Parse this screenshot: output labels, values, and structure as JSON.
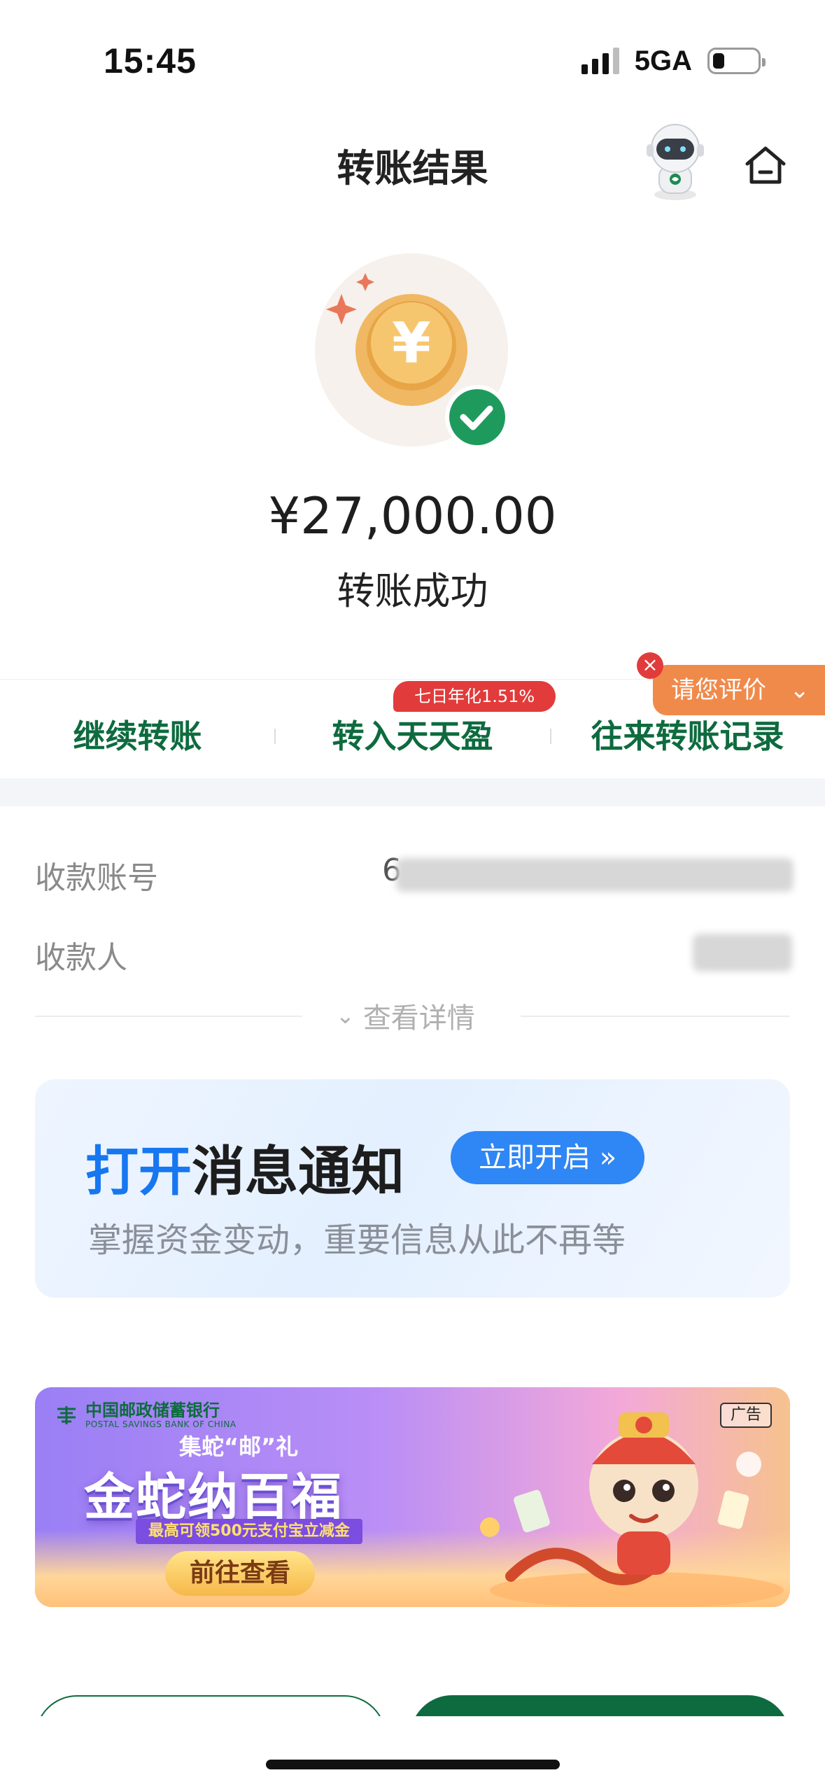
{
  "status_bar": {
    "time": "15:45",
    "network": "5GA",
    "signal_bars": 3,
    "battery_level": 0.2
  },
  "header": {
    "title": "转账结果",
    "mascot_icon": "astronaut-mascot-icon",
    "home_icon": "home-icon"
  },
  "result": {
    "icon": "coin-success-icon",
    "amount": "¥27,000.00",
    "status": "转账成功"
  },
  "actions": {
    "continue_transfer": "继续转账",
    "transfer_in": "转入天天盈",
    "promo_badge": "七日年化1.51%",
    "history": "往来转账记录",
    "rate_tab": "请您评价",
    "rate_close_icon": "close-icon",
    "accent_color": "#0e6b3f"
  },
  "info": {
    "account_label": "收款账号",
    "account_value_prefix": "6",
    "payee_label": "收款人",
    "details_link": "查看详情"
  },
  "notify_card": {
    "title_highlight": "打开",
    "title_rest": "消息通知",
    "button": "立即开启 »",
    "subtitle": "掌握资金变动，重要信息从此不再等"
  },
  "ad": {
    "bank_name_cn": "中国邮政储蓄银行",
    "bank_name_en": "POSTAL SAVINGS BANK OF CHINA",
    "tag": "广告",
    "kicker": "集蛇“邮”礼",
    "headline": "金蛇纳百福",
    "offer": "最高可领500元支付宝立减金",
    "cta": "前往查看",
    "art_icon": "lion-dance-snake-illustration"
  }
}
